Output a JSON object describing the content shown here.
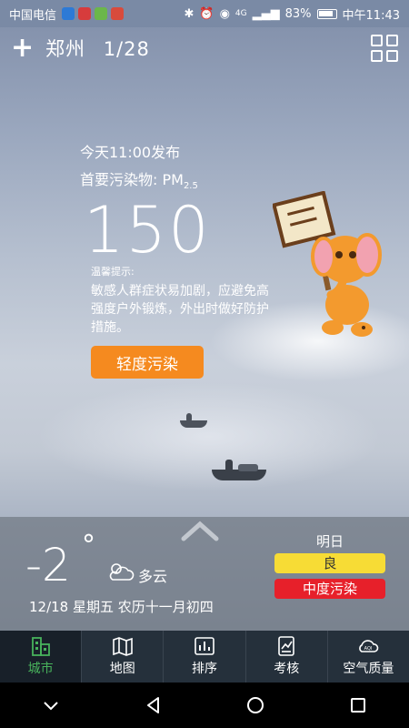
{
  "status_bar": {
    "carrier": "中国电信",
    "network": "4G",
    "battery": "83%",
    "time": "中午11:43"
  },
  "header": {
    "city": "郑州",
    "page": "1/28",
    "add_icon": "plus-icon",
    "menu_icon": "grid-icon"
  },
  "aqi": {
    "publish_time": "今天11:00发布",
    "pollutant_label": "首要污染物: PM",
    "pollutant_sub": "2.5",
    "value": "150",
    "tip_title": "温馨提示:",
    "tip_text": "敏感人群症状易加剧，应避免高强度户外锻炼，外出时做好防护措施。",
    "level": "轻度污染",
    "level_color": "#f58a1f"
  },
  "weather": {
    "temperature": "-2",
    "degree": "°",
    "condition": "多云",
    "date": "12/18 星期五 农历十一月初四",
    "icon": "partly-cloudy-icon"
  },
  "tomorrow": {
    "label": "明日",
    "aqi_level": "良",
    "aqi_color": "#f7dc35",
    "pollution_level": "中度污染",
    "pollution_color": "#e7202a"
  },
  "tabs": [
    {
      "label": "城市",
      "icon": "city-icon",
      "active": true
    },
    {
      "label": "地图",
      "icon": "map-icon",
      "active": false
    },
    {
      "label": "排序",
      "icon": "ranking-icon",
      "active": false
    },
    {
      "label": "考核",
      "icon": "assessment-icon",
      "active": false
    },
    {
      "label": "空气质量",
      "icon": "aqi-cloud-icon",
      "active": false
    }
  ],
  "accent_active_tab": "#48b25c"
}
